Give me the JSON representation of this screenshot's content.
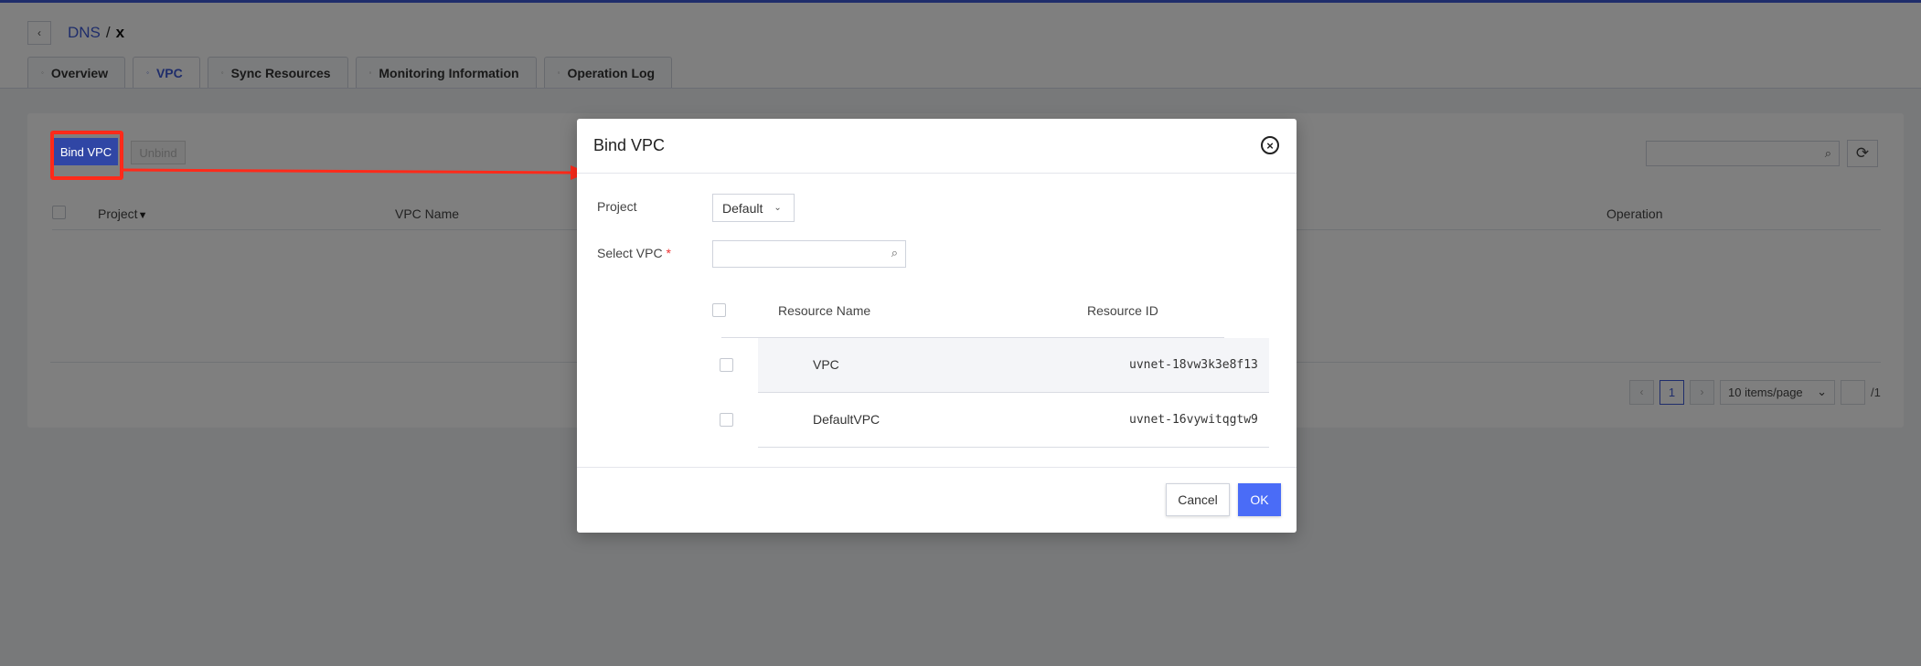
{
  "breadcrumb": {
    "back_icon": "chevron-left-icon",
    "parent": "DNS",
    "separator": "/",
    "current": "x"
  },
  "tabs": [
    {
      "label": "Overview",
      "active": false
    },
    {
      "label": "VPC",
      "active": true
    },
    {
      "label": "Sync Resources",
      "active": false
    },
    {
      "label": "Monitoring Information",
      "active": false
    },
    {
      "label": "Operation Log",
      "active": false
    }
  ],
  "toolbar": {
    "bind_label": "Bind VPC",
    "unbind_label": "Unbind"
  },
  "table": {
    "columns": {
      "project": "Project",
      "vpc_name": "VPC Name",
      "operation": "Operation"
    }
  },
  "pagination": {
    "current_page": "1",
    "page_size": "10 items/page",
    "total_pages": "/1"
  },
  "modal": {
    "title": "Bind VPC",
    "project_label": "Project",
    "project_value": "Default",
    "select_vpc_label": "Select VPC",
    "required_mark": "*",
    "columns": {
      "name": "Resource Name",
      "id": "Resource ID"
    },
    "rows": [
      {
        "name": "VPC",
        "id": "uvnet-18vw3k3e8f13"
      },
      {
        "name": "DefaultVPC",
        "id": "uvnet-16vywitqgtw9"
      }
    ],
    "cancel_label": "Cancel",
    "ok_label": "OK"
  },
  "colors": {
    "accent": "#3e5bd6",
    "ok_button": "#4a6cf7",
    "annotation": "#ff2a1a"
  }
}
